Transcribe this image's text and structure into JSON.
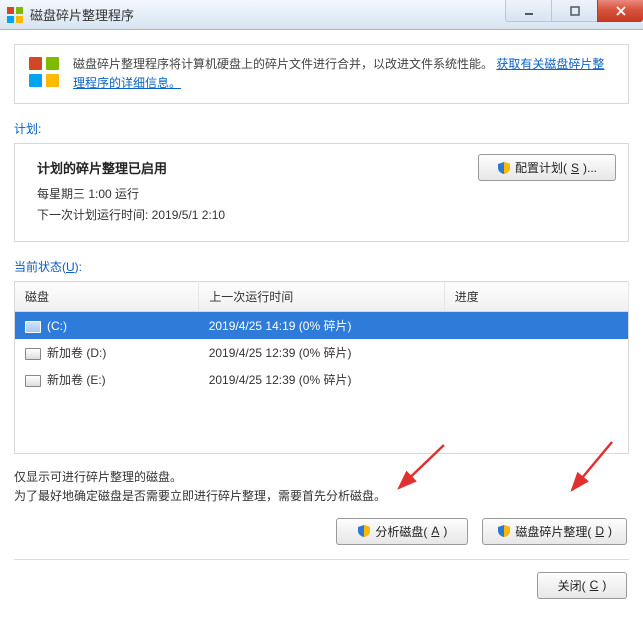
{
  "window": {
    "title": "磁盘碎片整理程序"
  },
  "info": {
    "text_prefix": "磁盘碎片整理程序将计算机硬盘上的碎片文件进行合并，以改进文件系统性能。",
    "link": "获取有关磁盘碎片整理程序的详细信息。"
  },
  "schedule": {
    "section_label_prefix": "计划",
    "section_label_suffix": ":",
    "heading": "计划的碎片整理已启用",
    "line1": "每星期三 1:00 运行",
    "line2": "下一次计划运行时间: 2019/5/1 2:10",
    "config_button": "配置计划(",
    "config_key": "S",
    "config_tail": ")..."
  },
  "status": {
    "section_label_prefix": "当前状态(",
    "section_label_key": "U",
    "section_label_suffix": "):",
    "columns": {
      "c1": "磁盘",
      "c2": "上一次运行时间",
      "c3": "进度"
    },
    "rows": [
      {
        "name": "(C:)",
        "last": "2019/4/25 14:19 (0% 碎片)",
        "progress": "",
        "selected": true,
        "sys": true
      },
      {
        "name": "新加卷 (D:)",
        "last": "2019/4/25 12:39 (0% 碎片)",
        "progress": "",
        "selected": false,
        "sys": false
      },
      {
        "name": "新加卷 (E:)",
        "last": "2019/4/25 12:39 (0% 碎片)",
        "progress": "",
        "selected": false,
        "sys": false
      }
    ]
  },
  "hint": {
    "l1": "仅显示可进行碎片整理的磁盘。",
    "l2": "为了最好地确定磁盘是否需要立即进行碎片整理，需要首先分析磁盘。"
  },
  "buttons": {
    "analyze_prefix": "分析磁盘(",
    "analyze_key": "A",
    "analyze_suffix": ")",
    "defrag_prefix": "磁盘碎片整理(",
    "defrag_key": "D",
    "defrag_suffix": ")",
    "close_prefix": "关闭(",
    "close_key": "C",
    "close_suffix": ")"
  }
}
